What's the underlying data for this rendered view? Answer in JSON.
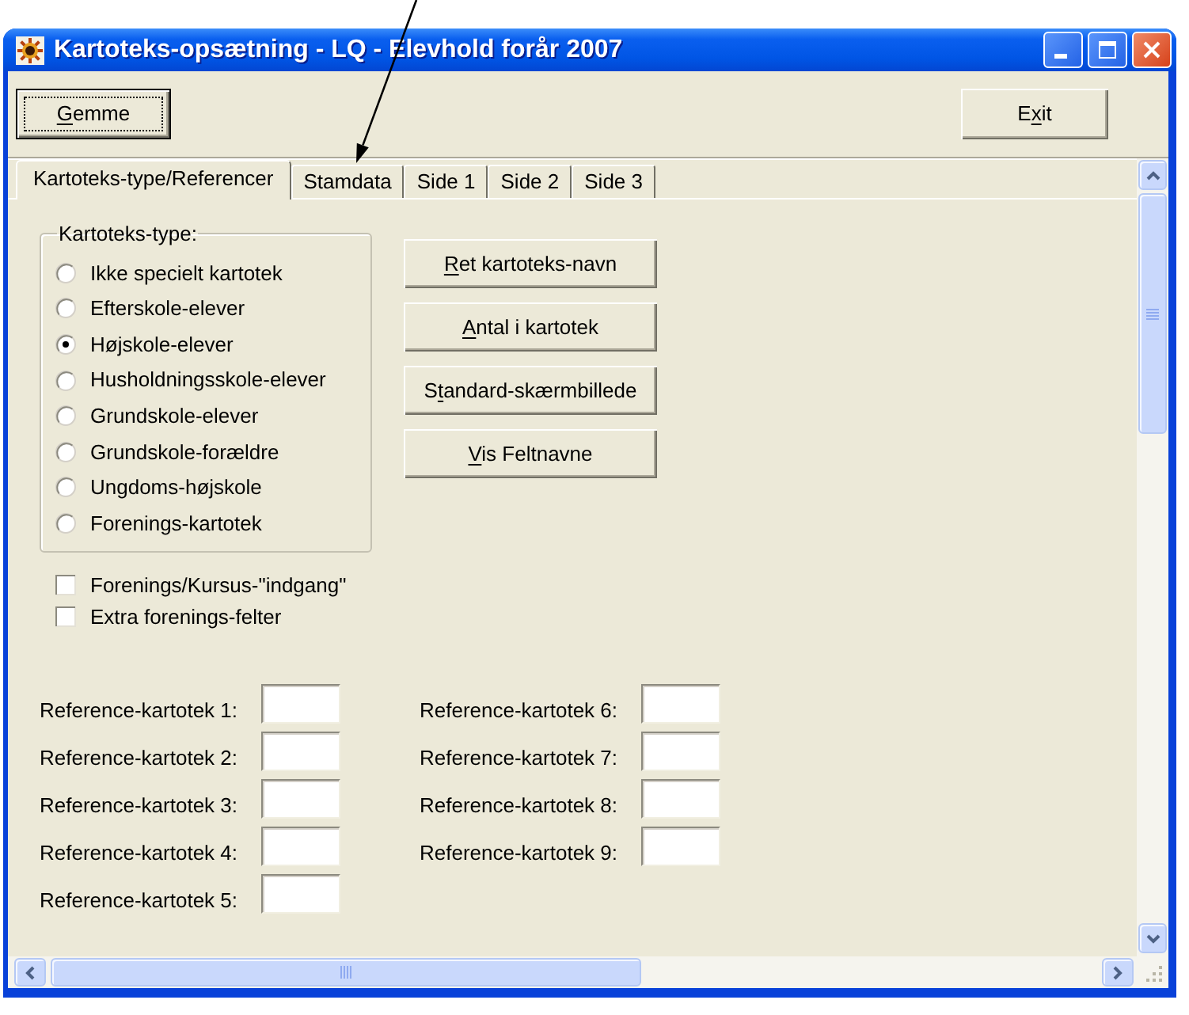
{
  "window": {
    "title": "Kartoteks-opsætning - LQ - Elevhold forår 2007"
  },
  "toolbar": {
    "buttons": [
      {
        "label": "Gemme",
        "access_key_second": false,
        "focused": true
      },
      {
        "label": "Exit",
        "access_key_second": true,
        "focused": false
      }
    ]
  },
  "tabs": [
    {
      "label": "Kartoteks-type/Referencer",
      "selected": true
    },
    {
      "label": "Stamdata",
      "selected": false
    },
    {
      "label": "Side 1",
      "selected": false
    },
    {
      "label": "Side 2",
      "selected": false
    },
    {
      "label": "Side 3",
      "selected": false
    }
  ],
  "type_group": {
    "legend": "Kartoteks-type:",
    "options": [
      {
        "label": "Ikke specielt kartotek",
        "selected": false
      },
      {
        "label": "Efterskole-elever",
        "selected": false
      },
      {
        "label": "Højskole-elever",
        "selected": true
      },
      {
        "label": "Husholdningsskole-elever",
        "selected": false
      },
      {
        "label": "Grundskole-elever",
        "selected": false
      },
      {
        "label": "Grundskole-forældre",
        "selected": false
      },
      {
        "label": "Ungdoms-højskole",
        "selected": false
      },
      {
        "label": "Forenings-kartotek",
        "selected": false
      }
    ]
  },
  "action_buttons": [
    {
      "label": "Ret kartoteks-navn",
      "access_key_second": false
    },
    {
      "label": "Antal i kartotek",
      "access_key_second": false
    },
    {
      "label": "Standard-skærmbillede",
      "access_key_second": true
    },
    {
      "label": "Vis Feltnavne",
      "access_key_second": false
    }
  ],
  "checkboxes": [
    {
      "label": "Forenings/Kursus-\"indgang\"",
      "checked": false
    },
    {
      "label": "Extra forenings-felter",
      "checked": false
    }
  ],
  "reference_columns": [
    {
      "fields": [
        {
          "label": "Reference-kartotek 1:"
        },
        {
          "label": "Reference-kartotek 2:"
        },
        {
          "label": "Reference-kartotek 3:"
        },
        {
          "label": "Reference-kartotek 4:"
        },
        {
          "label": "Reference-kartotek 5:"
        }
      ]
    },
    {
      "fields": [
        {
          "label": "Reference-kartotek 6:"
        },
        {
          "label": "Reference-kartotek 7:"
        },
        {
          "label": "Reference-kartotek 8:"
        },
        {
          "label": "Reference-kartotek 9:"
        }
      ]
    }
  ]
}
